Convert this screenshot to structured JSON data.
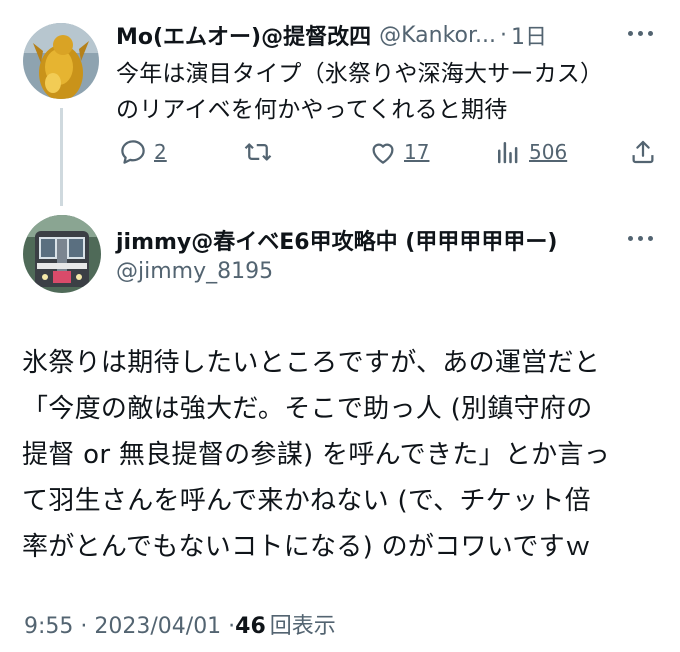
{
  "reply_context_tweet": {
    "display_name": "Mo(エムオー)@提督改四",
    "handle": "@Kankor...",
    "separator": "·",
    "time": "1日",
    "text": "今年は演目タイプ（氷祭りや深海大サーカス）\nのリアイベを何かやってくれると期待",
    "avatar_icon": "golden-figure-avatar",
    "actions": {
      "reply_count": "2",
      "retweet_count": "",
      "like_count": "17",
      "view_count": "506"
    }
  },
  "main_tweet": {
    "display_name": "jimmy@春イベE6甲攻略中 (甲甲甲甲甲ー)",
    "handle": "@jimmy_8195",
    "avatar_icon": "train-avatar",
    "text": "氷祭りは期待したいところですが、あの運営だと\n「今度の敵は強大だ。そこで助っ人 (別鎮守府の\n提督 or 無良提督の参謀) を呼んできた」とか言っ\nて羽生さんを呼んで来かねない (で、チケット倍\n率がとんでもないコトになる) のがコワいですｗ",
    "timestamp": "9:55 · 2023/04/01 · ",
    "view_count": "46",
    "view_label": "回表示"
  },
  "colors": {
    "text": "#0f1419",
    "muted": "#536471",
    "thread_line": "#cfd9de"
  }
}
